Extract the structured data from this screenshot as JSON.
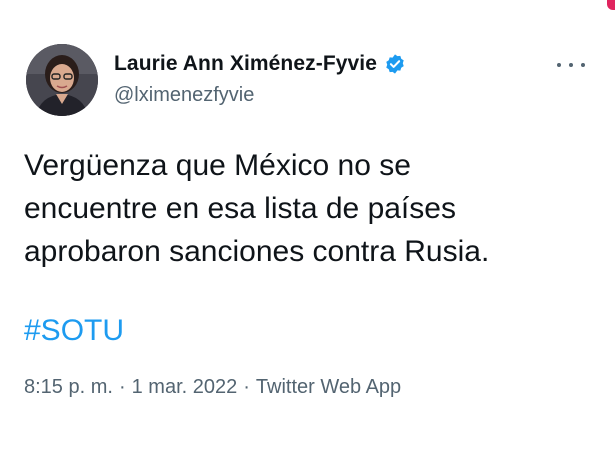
{
  "author": {
    "display_name": "Laurie Ann Ximénez-Fyvie",
    "handle": "@lximenezfyvie",
    "verified": true
  },
  "tweet": {
    "lines": [
      "Vergüenza que México no se",
      "encuentre en esa lista de países",
      "aprobaron sanciones contra Rusia."
    ],
    "hashtag": "#SOTU"
  },
  "meta": {
    "time": "8:15 p. m.",
    "date": "1 mar. 2022",
    "source": "Twitter Web App",
    "separator": "·"
  },
  "icons": {
    "verified": "verified-badge-icon",
    "more": "more-options-icon"
  },
  "colors": {
    "accent": "#1d9bf0",
    "text": "#0f1419",
    "secondary": "#536471"
  }
}
